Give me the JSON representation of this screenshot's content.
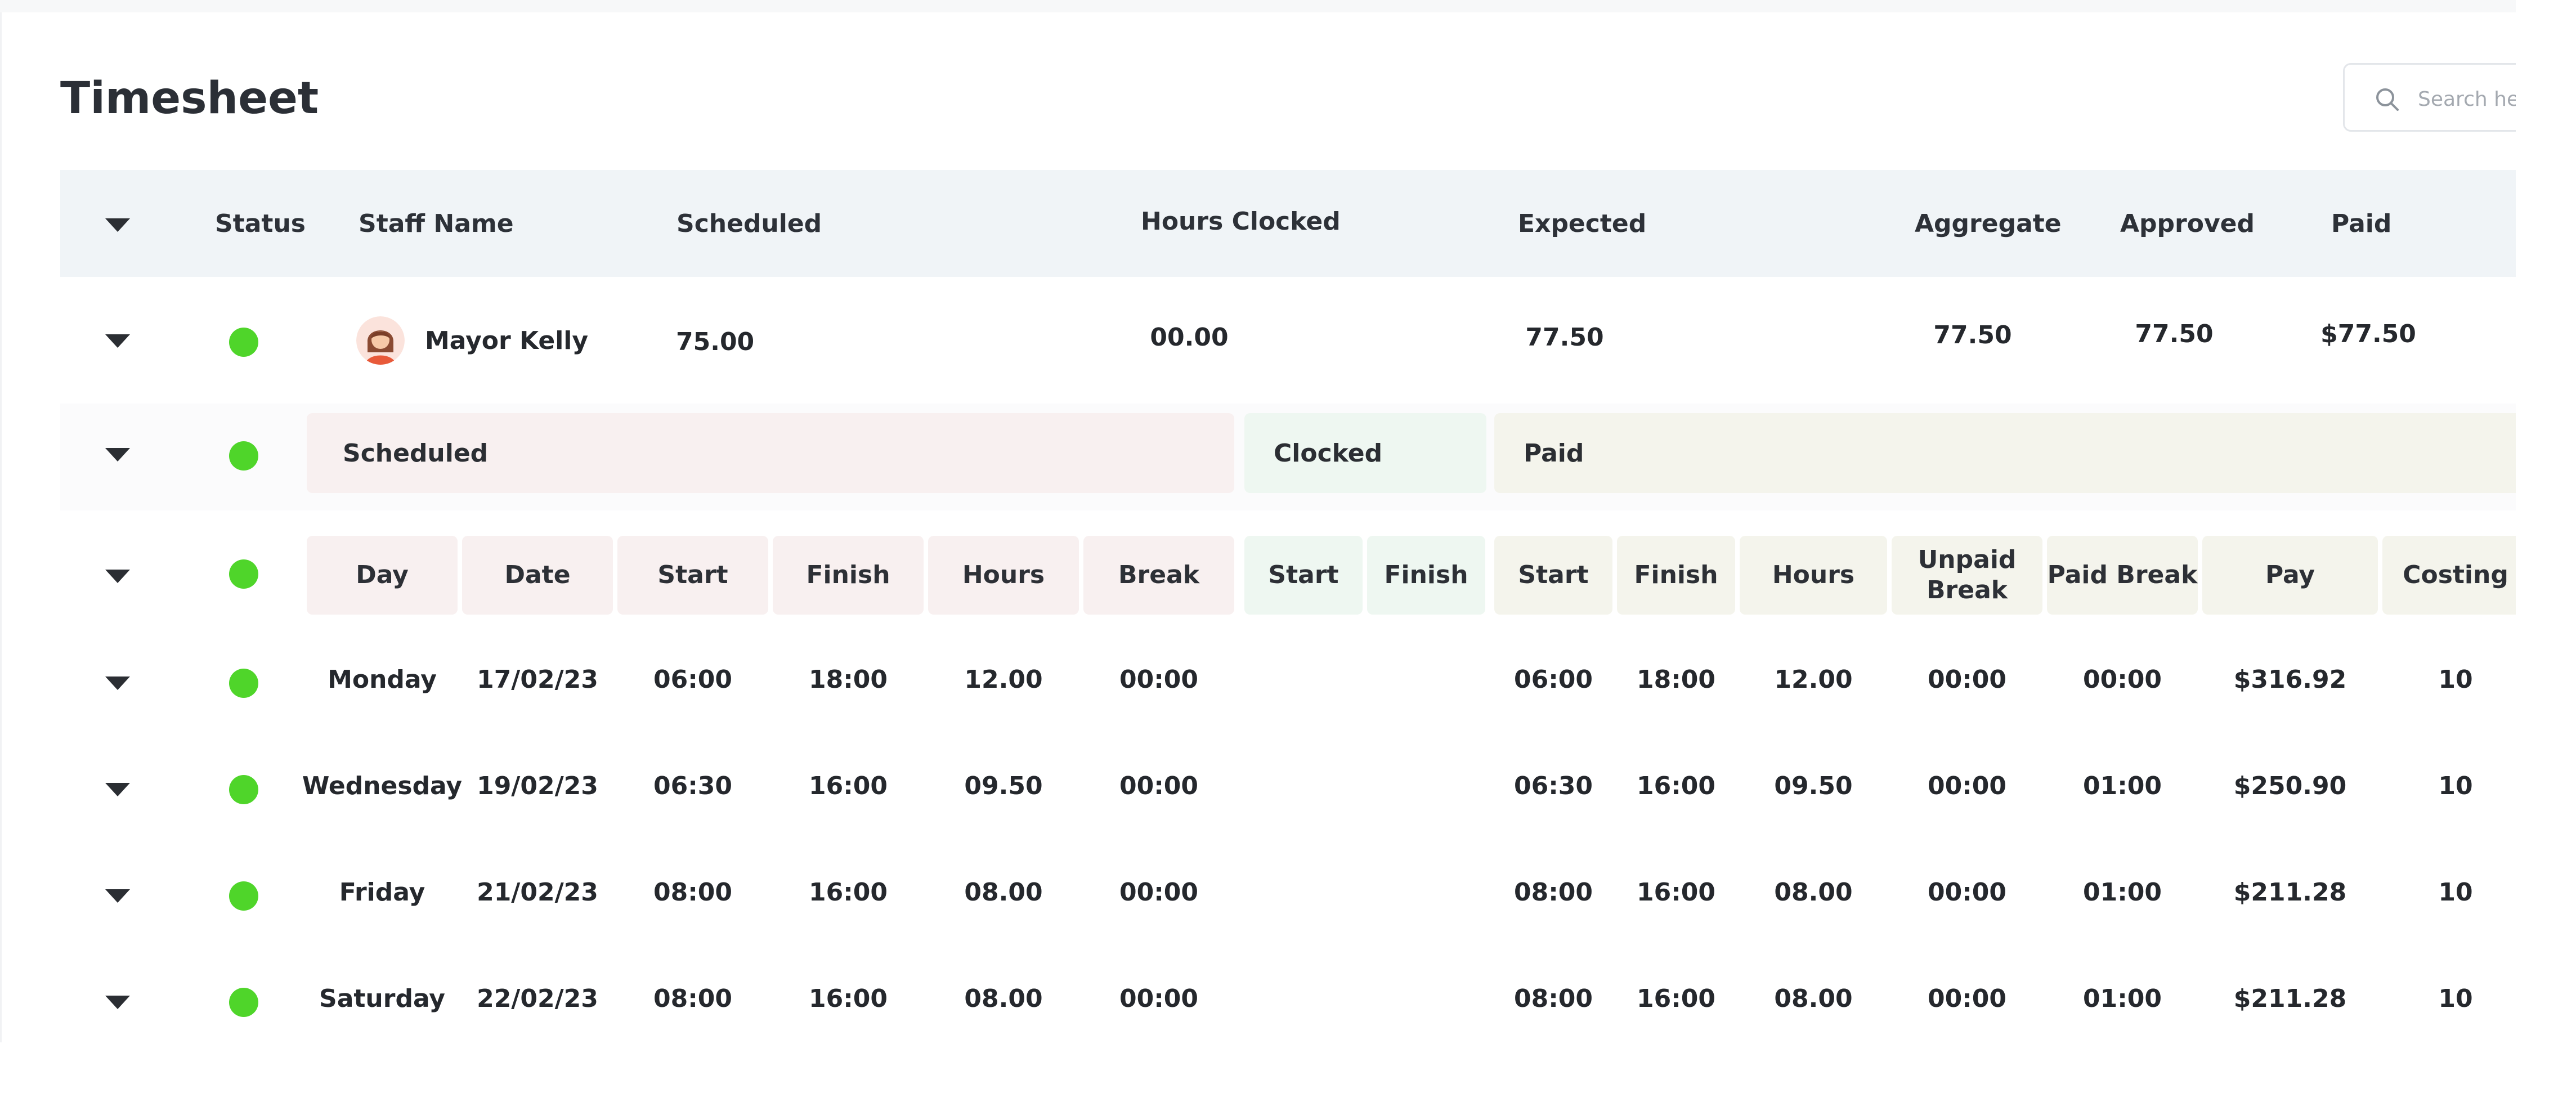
{
  "page": {
    "title": "Timesheet"
  },
  "search": {
    "placeholder": "Search here"
  },
  "header": {
    "status": "Status",
    "staff_name": "Staff Name",
    "scheduled": "Scheduled",
    "hours_clocked": "Hours Clocked",
    "expected": "Expected",
    "aggregate": "Aggregate",
    "approved": "Approved",
    "paid": "Paid"
  },
  "staff": {
    "name": "Mayor Kelly",
    "scheduled": "75.00",
    "hours_clocked": "00.00",
    "expected": "77.50",
    "aggregate": "77.50",
    "approved": "77.50",
    "paid": "$77.50"
  },
  "sections": {
    "scheduled": "Scheduled",
    "clocked": "Clocked",
    "paid": "Paid"
  },
  "columns": {
    "day": "Day",
    "date": "Date",
    "start": "Start",
    "finish": "Finish",
    "hours": "Hours",
    "break": "Break",
    "clocked_start": "Start",
    "clocked_finish": "Finish",
    "paid_start": "Start",
    "paid_finish": "Finish",
    "paid_hours": "Hours",
    "unpaid_break": "Unpaid Break",
    "paid_break": "Paid Break",
    "pay": "Pay",
    "costing": "Costing"
  },
  "shifts": [
    {
      "day": "Monday",
      "date": "17/02/23",
      "start": "06:00",
      "finish": "18:00",
      "hours": "12.00",
      "break": "00:00",
      "paid_start": "06:00",
      "paid_finish": "18:00",
      "paid_hours": "12.00",
      "unpaid_break": "00:00",
      "paid_break": "00:00",
      "pay": "$316.92",
      "costing": "10"
    },
    {
      "day": "Wednesday",
      "date": "19/02/23",
      "start": "06:30",
      "finish": "16:00",
      "hours": "09.50",
      "break": "00:00",
      "paid_start": "06:30",
      "paid_finish": "16:00",
      "paid_hours": "09.50",
      "unpaid_break": "00:00",
      "paid_break": "01:00",
      "pay": "$250.90",
      "costing": "10"
    },
    {
      "day": "Friday",
      "date": "21/02/23",
      "start": "08:00",
      "finish": "16:00",
      "hours": "08.00",
      "break": "00:00",
      "paid_start": "08:00",
      "paid_finish": "16:00",
      "paid_hours": "08.00",
      "unpaid_break": "00:00",
      "paid_break": "01:00",
      "pay": "$211.28",
      "costing": "10"
    },
    {
      "day": "Saturday",
      "date": "22/02/23",
      "start": "08:00",
      "finish": "16:00",
      "hours": "08.00",
      "break": "00:00",
      "paid_start": "08:00",
      "paid_finish": "16:00",
      "paid_hours": "08.00",
      "unpaid_break": "00:00",
      "paid_break": "01:00",
      "pay": "$211.28",
      "costing": "10"
    }
  ],
  "icons": {
    "search": "search-icon",
    "expand": "chevron-down-icon",
    "status": "status-dot-icon",
    "avatar": "avatar"
  },
  "colors": {
    "status_active": "#4fd52a",
    "header_bg": "#f0f4f7",
    "scheduled_bg": "#f8f0f0",
    "clocked_bg": "#eef7f1",
    "paid_bg": "#f4f4ec"
  }
}
